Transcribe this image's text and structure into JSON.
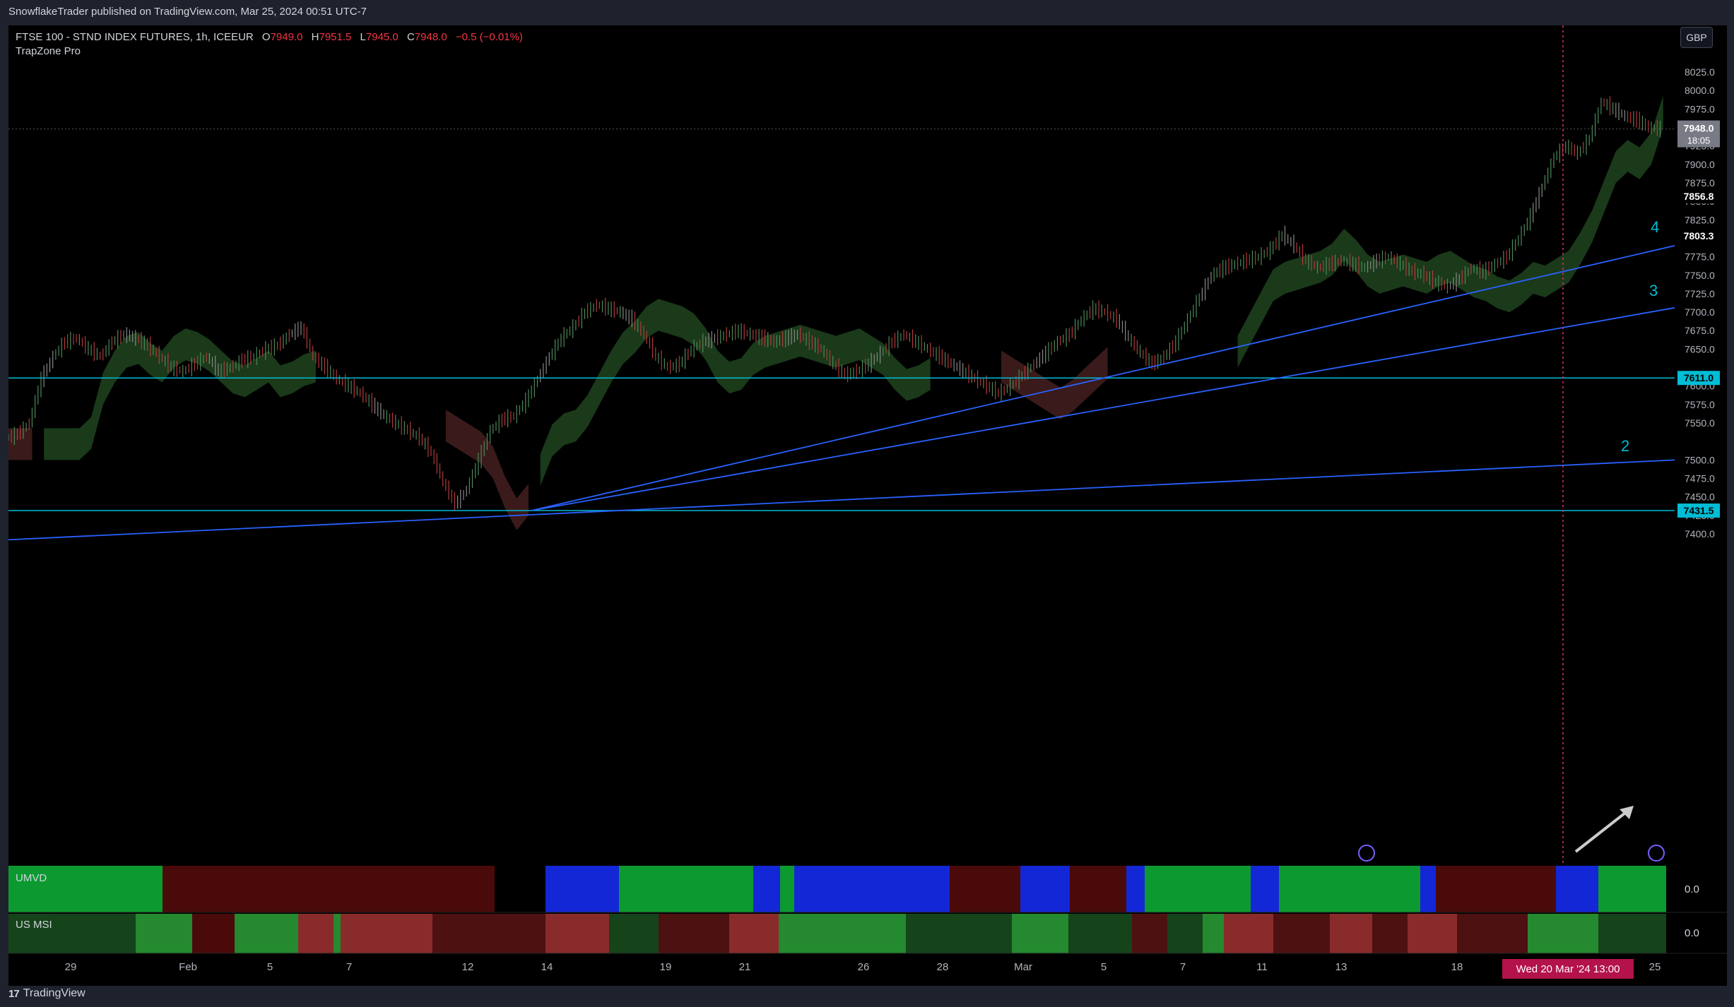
{
  "header": {
    "published": "SnowflakeTrader published on TradingView.com, Mar 25, 2024 00:51 UTC-7"
  },
  "legend": {
    "symbol": "FTSE 100 - STND INDEX FUTURES, 1h, ICEEUR",
    "o_label": "O",
    "o_value": "7949.0",
    "h_label": "H",
    "h_value": "7951.5",
    "l_label": "L",
    "l_value": "7945.0",
    "c_label": "C",
    "c_value": "7948.0",
    "change": "−0.5 (−0.01%)",
    "indicator": "TrapZone Pro"
  },
  "currency": "GBP",
  "footer": {
    "brand": "TradingView"
  },
  "panes": {
    "umvd_label": "UMVD",
    "umvd_value": "0.0",
    "usmsi_label": "US MSI",
    "usmsi_value": "0.0"
  },
  "price_tags": {
    "last": "7948.0",
    "countdown": "18:05",
    "level_a": "7856.8",
    "level_b": "7803.3",
    "hline_1": "7611.0",
    "hline_2": "7431.5"
  },
  "crosshair_date": "Wed 20 Mar '24   13:00",
  "trend_labels": [
    "2",
    "3",
    "4"
  ],
  "colors": {
    "up": "#26a69a",
    "down": "#f23645",
    "cloud_green": "#1b3d1b",
    "cloud_red": "#3d1b1b",
    "hline": "#00bcd4",
    "trend": "#2962ff",
    "green": "#0c9a30",
    "darkred": "#4a0a0a",
    "blue": "#1427d6"
  },
  "chart_data": {
    "type": "candlestick",
    "title": "FTSE 100 - STND INDEX FUTURES, 1h, ICEEUR",
    "ylim": [
      7375,
      8050
    ],
    "y_ticks": [
      "8025.0",
      "8000.0",
      "7975.0",
      "7925.0",
      "7900.0",
      "7875.0",
      "7850.0",
      "7825.0",
      "7775.0",
      "7750.0",
      "7725.0",
      "7700.0",
      "7675.0",
      "7650.0",
      "7600.0",
      "7575.0",
      "7550.0",
      "7500.0",
      "7475.0",
      "7450.0",
      "7425.0",
      "7400.0"
    ],
    "x_ticks": [
      "29",
      "Feb",
      "5",
      "7",
      "12",
      "14",
      "19",
      "21",
      "26",
      "28",
      "Mar",
      "5",
      "7",
      "11",
      "13",
      "18",
      "25"
    ],
    "horizontal_lines": [
      7611.0,
      7431.5
    ],
    "close_series": [
      7535,
      7550,
      7610,
      7640,
      7660,
      7665,
      7650,
      7640,
      7660,
      7670,
      7665,
      7655,
      7640,
      7625,
      7620,
      7630,
      7640,
      7620,
      7625,
      7635,
      7640,
      7650,
      7655,
      7670,
      7680,
      7640,
      7625,
      7610,
      7600,
      7590,
      7575,
      7560,
      7550,
      7540,
      7530,
      7510,
      7470,
      7440,
      7460,
      7500,
      7540,
      7555,
      7560,
      7580,
      7610,
      7640,
      7665,
      7680,
      7700,
      7710,
      7705,
      7700,
      7690,
      7670,
      7640,
      7625,
      7630,
      7650,
      7660,
      7665,
      7670,
      7675,
      7670,
      7665,
      7660,
      7665,
      7670,
      7660,
      7650,
      7630,
      7615,
      7620,
      7630,
      7645,
      7660,
      7670,
      7660,
      7650,
      7640,
      7630,
      7620,
      7610,
      7600,
      7590,
      7600,
      7615,
      7630,
      7645,
      7660,
      7670,
      7690,
      7705,
      7700,
      7690,
      7665,
      7645,
      7630,
      7640,
      7660,
      7690,
      7720,
      7750,
      7760,
      7765,
      7770,
      7775,
      7785,
      7805,
      7790,
      7770,
      7760,
      7765,
      7770,
      7765,
      7760,
      7770,
      7775,
      7765,
      7755,
      7750,
      7740,
      7735,
      7745,
      7760,
      7755,
      7765,
      7775,
      7800,
      7830,
      7870,
      7910,
      7925,
      7915,
      7935,
      7985,
      7975,
      7965,
      7960,
      7950,
      7948
    ],
    "trend_lines": [
      {
        "label": "2",
        "from": [
          "Jan 23",
          7392
        ],
        "to": [
          "Mar 25",
          7500
        ]
      },
      {
        "label": "3",
        "from": [
          "Feb 13",
          7431.5
        ],
        "to": [
          "Mar 25",
          7706
        ]
      },
      {
        "label": "4",
        "from": [
          "Feb 13",
          7431.5
        ],
        "to": [
          "Mar 25",
          7790
        ]
      }
    ]
  }
}
